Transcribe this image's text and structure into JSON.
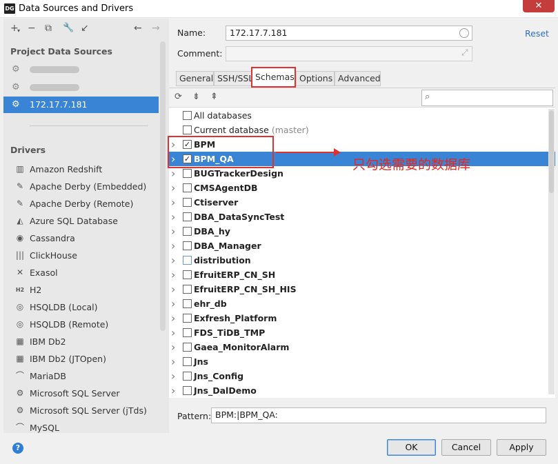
{
  "window": {
    "app_icon": "DG",
    "title": "Data Sources and Drivers",
    "close": "✕"
  },
  "left_toolbar": {
    "add": "+",
    "add_caret": "▾",
    "remove": "−",
    "duplicate": "⧉",
    "settings": "🔧",
    "import": "↙",
    "back": "←",
    "forward": "→"
  },
  "project": {
    "heading": "Project Data Sources",
    "items": [
      {
        "label": "",
        "blurred": true,
        "icon": "mssql-icon"
      },
      {
        "label": "",
        "blurred": true,
        "icon": "mssql-icon"
      },
      {
        "label": "172.17.7.181",
        "selected": true,
        "icon": "mssql-icon"
      }
    ]
  },
  "drivers": {
    "heading": "Drivers",
    "items": [
      {
        "label": "Amazon Redshift",
        "icon": "redshift-icon",
        "glyph": "▥"
      },
      {
        "label": "Apache Derby (Embedded)",
        "icon": "derby-icon",
        "glyph": "✎"
      },
      {
        "label": "Apache Derby (Remote)",
        "icon": "derby-icon",
        "glyph": "✎"
      },
      {
        "label": "Azure SQL Database",
        "icon": "azure-icon",
        "glyph": "◭"
      },
      {
        "label": "Cassandra",
        "icon": "cassandra-icon",
        "glyph": "◉"
      },
      {
        "label": "ClickHouse",
        "icon": "clickhouse-icon",
        "glyph": "|||"
      },
      {
        "label": "Exasol",
        "icon": "exasol-icon",
        "glyph": "✕"
      },
      {
        "label": "H2",
        "icon": "h2-icon",
        "glyph": "H2"
      },
      {
        "label": "HSQLDB (Local)",
        "icon": "hsqldb-icon",
        "glyph": "◎"
      },
      {
        "label": "HSQLDB (Remote)",
        "icon": "hsqldb-icon",
        "glyph": "◎"
      },
      {
        "label": "IBM Db2",
        "icon": "db2-icon",
        "glyph": "▦"
      },
      {
        "label": "IBM Db2 (JTOpen)",
        "icon": "db2-icon",
        "glyph": "▦"
      },
      {
        "label": "MariaDB",
        "icon": "mariadb-icon",
        "glyph": "⌒"
      },
      {
        "label": "Microsoft SQL Server",
        "icon": "mssql-icon",
        "glyph": "⚙"
      },
      {
        "label": "Microsoft SQL Server (jTds)",
        "icon": "mssql-icon",
        "glyph": "⚙"
      },
      {
        "label": "MySQL",
        "icon": "mysql-icon",
        "glyph": "⌒"
      }
    ]
  },
  "form": {
    "name_label": "Name:",
    "name_value": "172.17.7.181",
    "comment_label": "Comment:",
    "comment_value": "",
    "reset_link": "Reset",
    "expand_glyph": "⤢"
  },
  "tabs": [
    {
      "label": "General"
    },
    {
      "label": "SSH/SSL"
    },
    {
      "label": "Schemas",
      "active": true
    },
    {
      "label": "Options"
    },
    {
      "label": "Advanced"
    }
  ],
  "schema_toolbar": {
    "refresh": "⟳",
    "expand_all": "⇟",
    "collapse_all": "⇞",
    "search_placeholder": "",
    "search_glyph": "⌕"
  },
  "schemas": [
    {
      "name": "All databases",
      "checked": false,
      "arrow": false,
      "bold": false
    },
    {
      "name": "Current database",
      "hint": "(master)",
      "checked": false,
      "arrow": false,
      "bold": false
    },
    {
      "name": "BPM",
      "checked": true,
      "arrow": true,
      "bold": true
    },
    {
      "name": "BPM_QA",
      "checked": true,
      "arrow": true,
      "bold": true,
      "selected": true
    },
    {
      "name": "BUGTrackerDesign",
      "checked": false,
      "arrow": true,
      "bold": true
    },
    {
      "name": "CMSAgentDB",
      "checked": false,
      "arrow": true,
      "bold": true
    },
    {
      "name": "Ctiserver",
      "checked": false,
      "arrow": true,
      "bold": true
    },
    {
      "name": "DBA_DataSyncTest",
      "checked": false,
      "arrow": true,
      "bold": true
    },
    {
      "name": "DBA_hy",
      "checked": false,
      "arrow": true,
      "bold": true
    },
    {
      "name": "DBA_Manager",
      "checked": false,
      "arrow": true,
      "bold": true
    },
    {
      "name": "distribution",
      "checked": false,
      "arrow": true,
      "bold": true,
      "blue_box": true
    },
    {
      "name": "EfruitERP_CN_SH",
      "checked": false,
      "arrow": true,
      "bold": true
    },
    {
      "name": "EfruitERP_CN_SH_HIS",
      "checked": false,
      "arrow": true,
      "bold": true
    },
    {
      "name": "ehr_db",
      "checked": false,
      "arrow": true,
      "bold": true
    },
    {
      "name": "Exfresh_Platform",
      "checked": false,
      "arrow": true,
      "bold": true
    },
    {
      "name": "FDS_TiDB_TMP",
      "checked": false,
      "arrow": true,
      "bold": true
    },
    {
      "name": "Gaea_MonitorAlarm",
      "checked": false,
      "arrow": true,
      "bold": true
    },
    {
      "name": "Jns",
      "checked": false,
      "arrow": true,
      "bold": true
    },
    {
      "name": "Jns_Config",
      "checked": false,
      "arrow": true,
      "bold": true
    },
    {
      "name": "Jns_DalDemo",
      "checked": false,
      "arrow": true,
      "bold": true
    }
  ],
  "annotation": {
    "text": "只勾选需要的数据库",
    "color": "#e8261c"
  },
  "pattern": {
    "label": "Pattern:",
    "value": "BPM:|BPM_QA:"
  },
  "buttons": {
    "help": "?",
    "ok": "OK",
    "cancel": "Cancel",
    "apply": "Apply"
  },
  "colors": {
    "selection": "#3a84d6",
    "annotation_red": "#e03030",
    "link": "#2e6ec2"
  }
}
